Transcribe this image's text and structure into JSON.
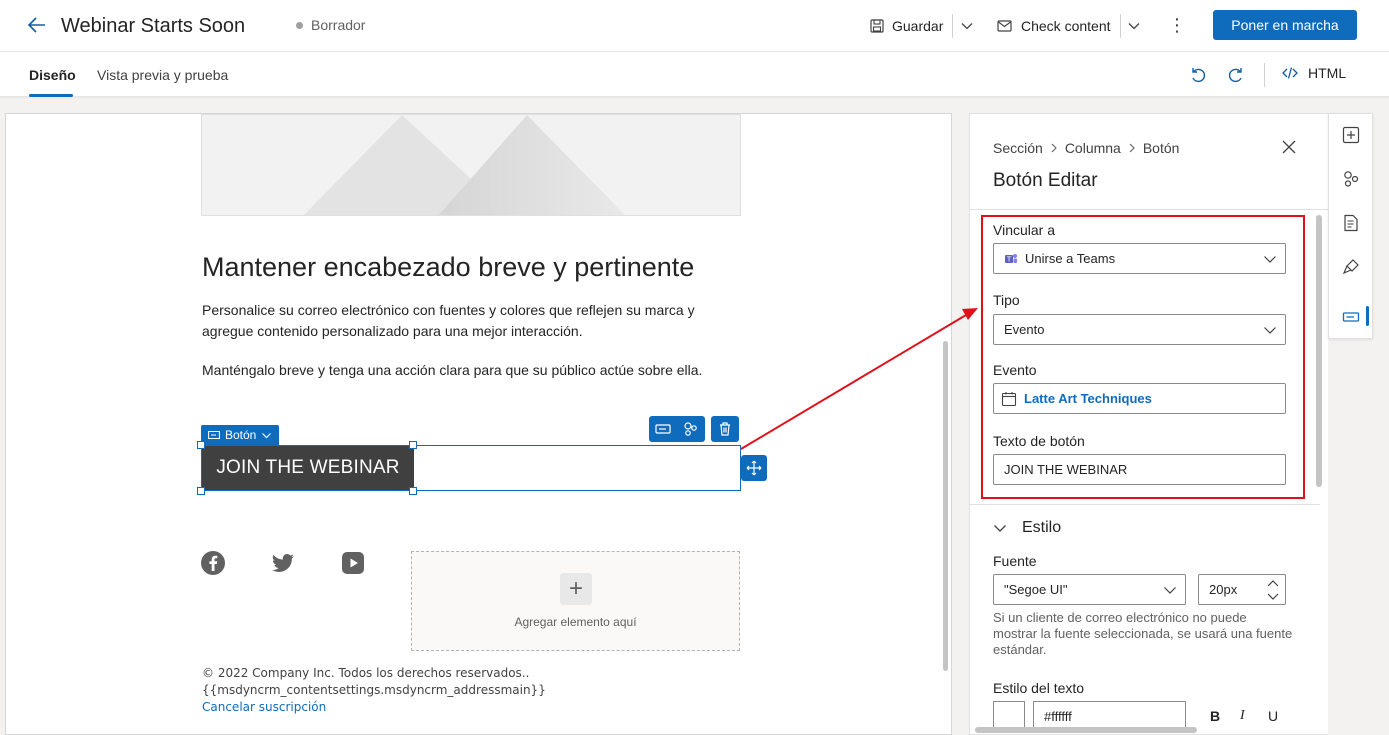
{
  "header": {
    "title": "Webinar Starts Soon",
    "status": "Borrador",
    "save_label": "Guardar",
    "check_label": "Check content",
    "primary_label": "Poner en marcha"
  },
  "tabs": [
    {
      "label": "Diseño",
      "active": true
    },
    {
      "label": "Vista previa y prueba",
      "active": false
    }
  ],
  "toolbar": {
    "html_label": "HTML"
  },
  "canvas": {
    "heading": "Mantener encabezado breve y pertinente",
    "paragraph1": "Personalice su correo electrónico con fuentes y colores que reflejen su marca y agregue contenido personalizado para una mejor interacción.",
    "paragraph2": "Manténgalo breve y tenga una acción clara para que su público actúe sobre ella.",
    "button_tag": "Botón",
    "button_text": "JOIN THE WEBINAR",
    "add_element_label": "Agregar elemento aquí",
    "footer_copyright": "© 2022 Company Inc. Todos los derechos reservados..",
    "footer_address": "{{msdyncrm_contentsettings.msdyncrm_addressmain}}",
    "unsubscribe": "Cancelar suscripción"
  },
  "panel": {
    "breadcrumb": [
      "Sección",
      "Columna",
      "Botón"
    ],
    "title": "Botón Editar",
    "link_label": "Vincular a",
    "link_value": "Unirse a Teams",
    "type_label": "Tipo",
    "type_value": "Evento",
    "event_label": "Evento",
    "event_value": "Latte Art Techniques",
    "button_text_label": "Texto de botón",
    "button_text_value": "JOIN THE WEBINAR",
    "style_section": "Estilo",
    "font_label": "Fuente",
    "font_value": "\"Segoe UI\"",
    "font_size": "20px",
    "font_help": "Si un cliente de correo electrónico no puede mostrar la fuente seleccionada, se usará una fuente estándar.",
    "text_style_label": "Estilo del texto",
    "text_color": "#ffffff",
    "bold": "B",
    "italic": "I",
    "underline": "U"
  },
  "colors": {
    "accent": "#0f6cbd",
    "annotation": "#e0101b",
    "button_bg": "#404040"
  }
}
